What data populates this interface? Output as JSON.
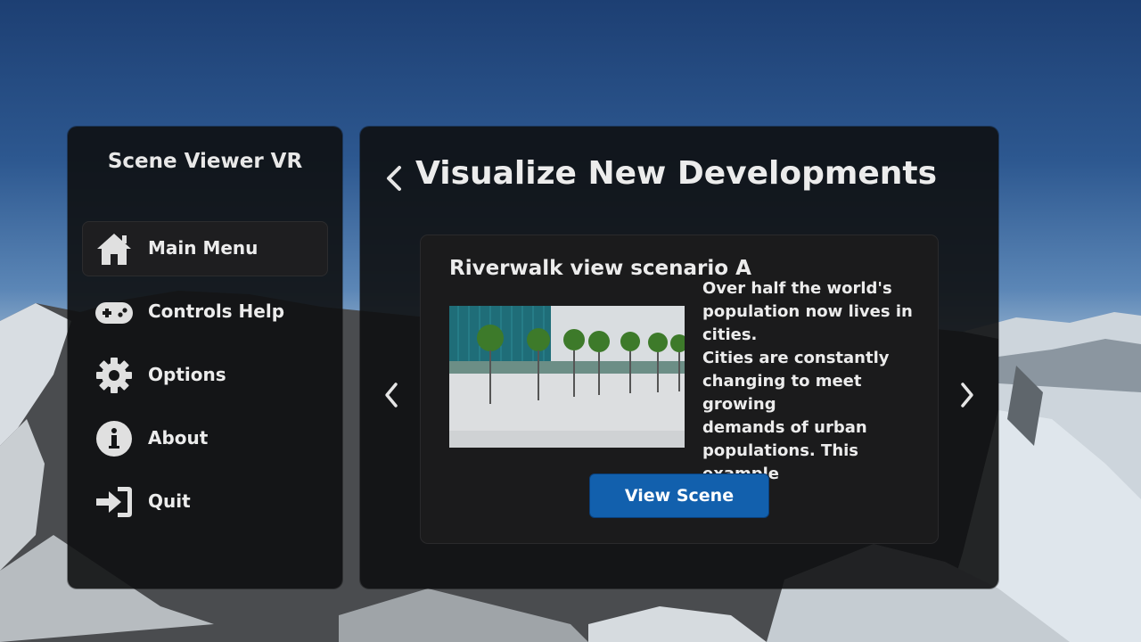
{
  "sidebar": {
    "title": "Scene Viewer VR",
    "items": [
      {
        "label": "Main Menu",
        "icon": "home-icon",
        "selected": true
      },
      {
        "label": "Controls Help",
        "icon": "gamepad-icon",
        "selected": false
      },
      {
        "label": "Options",
        "icon": "gear-icon",
        "selected": false
      },
      {
        "label": "About",
        "icon": "info-icon",
        "selected": false
      },
      {
        "label": "Quit",
        "icon": "sign-in-icon",
        "selected": false
      }
    ]
  },
  "main": {
    "back_icon": "chevron-left-icon",
    "title": "Visualize New Developments",
    "card": {
      "title": "Riverwalk view scenario A",
      "description": "Over half the world's\npopulation now lives in\ncities.\nCities are constantly\nchanging to meet growing\ndemands of urban\npopulations.  This example\nil...",
      "button_label": "View Scene",
      "thumbnail_icon": "scene-thumbnail"
    },
    "prev_icon": "chevron-left-icon",
    "next_icon": "chevron-right-icon"
  },
  "colors": {
    "accent": "#1260ad",
    "panel": "#0e0f11",
    "text": "#ececec"
  }
}
